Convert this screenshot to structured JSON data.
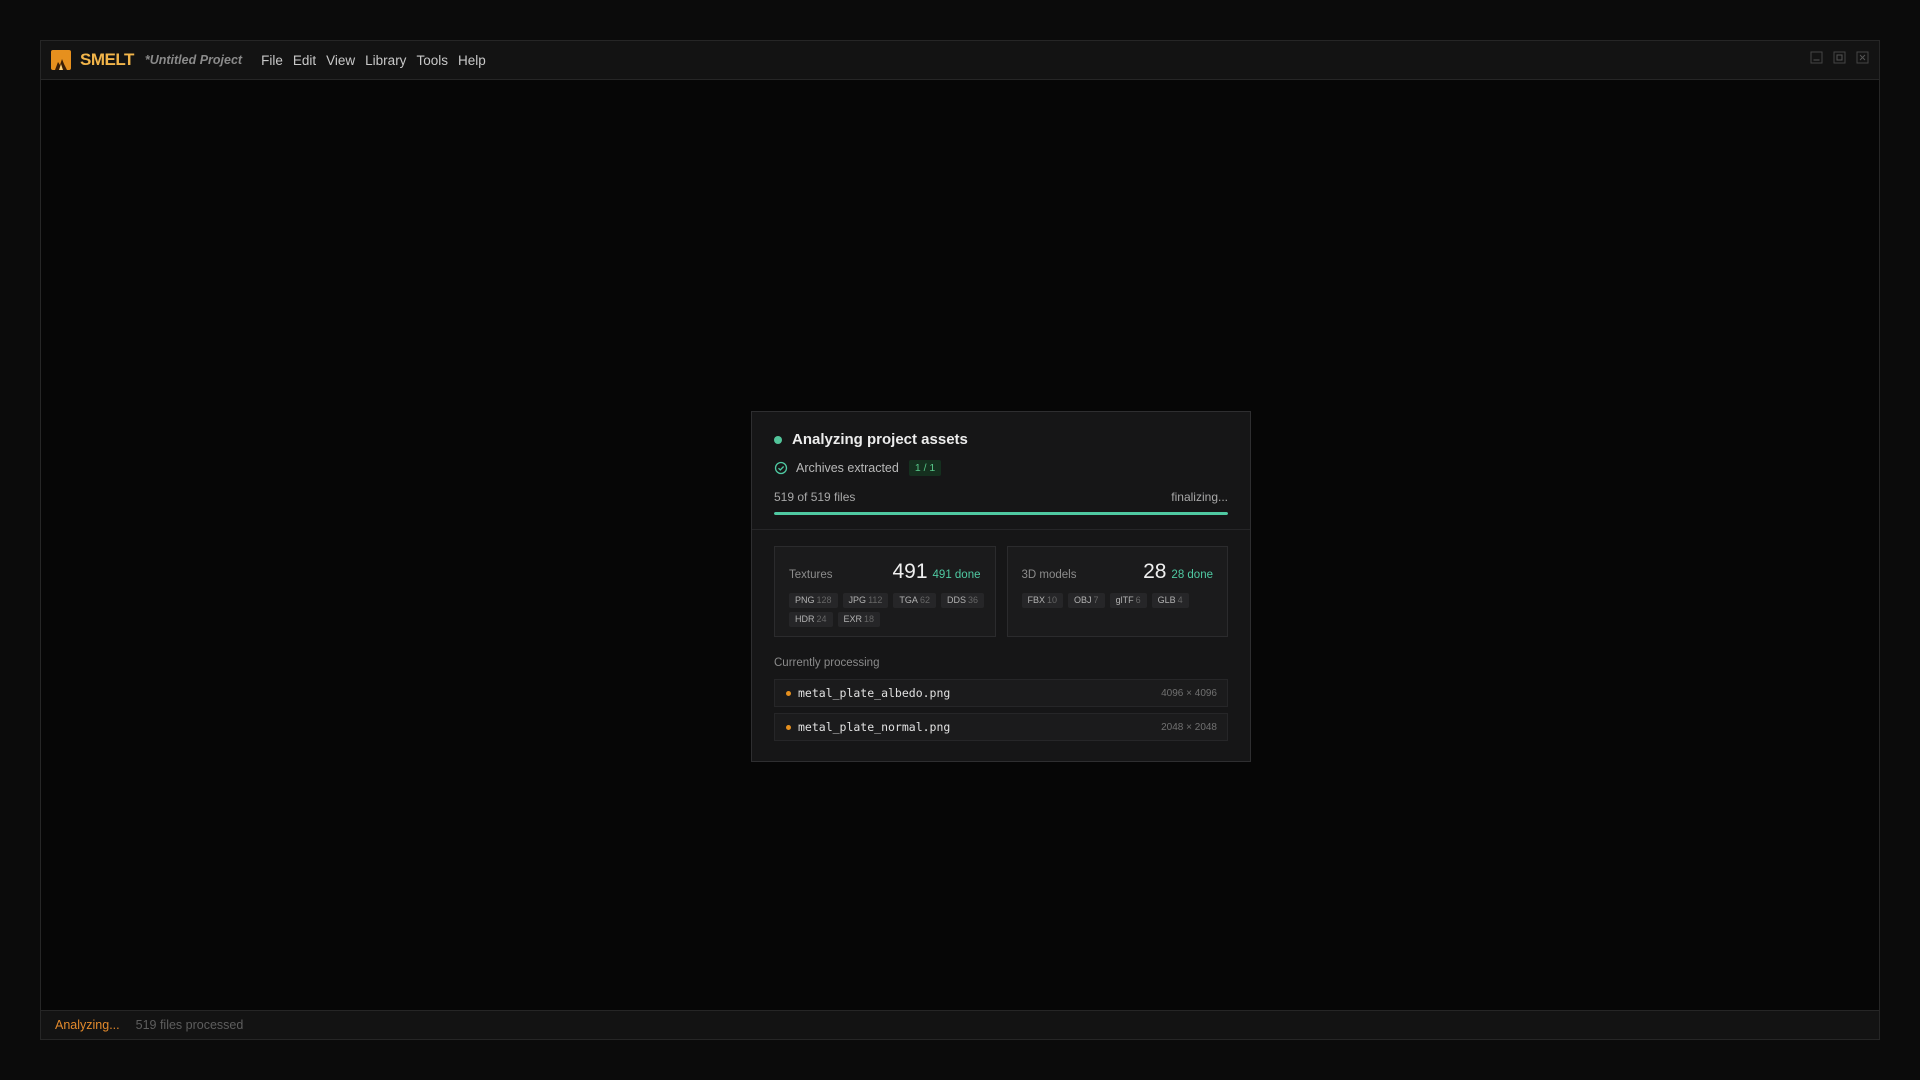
{
  "app": {
    "name": "SMELT",
    "project_title": "*Untitled Project",
    "brand_color": "#f2b54a"
  },
  "menu": {
    "items": [
      {
        "label": "File"
      },
      {
        "label": "Edit"
      },
      {
        "label": "View"
      },
      {
        "label": "Library"
      },
      {
        "label": "Tools"
      },
      {
        "label": "Help"
      }
    ]
  },
  "window_controls": [
    "minimize-icon",
    "maximize-icon",
    "close-icon"
  ],
  "dialog": {
    "title": "Analyzing project assets",
    "archives": {
      "label": "Archives extracted",
      "badge": "1 / 1"
    },
    "progress": {
      "text": "519 of 519 files",
      "state": "finalizing...",
      "fraction": 1.0
    },
    "stats": [
      {
        "label": "Textures",
        "count": "491",
        "done": "491 done",
        "chips": [
          {
            "type": "PNG",
            "count": "128"
          },
          {
            "type": "JPG",
            "count": "112"
          },
          {
            "type": "TGA",
            "count": "62"
          },
          {
            "type": "DDS",
            "count": "36"
          },
          {
            "type": "HDR",
            "count": "24"
          },
          {
            "type": "EXR",
            "count": "18"
          }
        ]
      },
      {
        "label": "3D models",
        "count": "28",
        "done": "28 done",
        "chips": [
          {
            "type": "FBX",
            "count": "10"
          },
          {
            "type": "OBJ",
            "count": "7"
          },
          {
            "type": "glTF",
            "count": "6"
          },
          {
            "type": "GLB",
            "count": "4"
          }
        ]
      }
    ],
    "processing": {
      "label": "Currently processing",
      "items": [
        {
          "name": "metal_plate_albedo.png",
          "resolution": "4096 × 4096"
        },
        {
          "name": "metal_plate_normal.png",
          "resolution": "2048 × 2048"
        }
      ]
    }
  },
  "status": {
    "state": "Analyzing...",
    "files": "519 files processed"
  }
}
